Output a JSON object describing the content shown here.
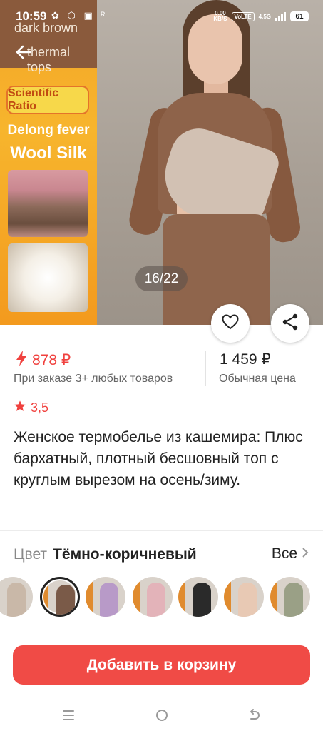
{
  "status_bar": {
    "time": "10:59",
    "net_speed_value": "0.00",
    "net_speed_unit": "KB/S",
    "volte": "VoLTE",
    "network": "4.5G",
    "battery": "61"
  },
  "gallery": {
    "counter": "16/22",
    "promo": {
      "color_name": "dark brown",
      "product_name": "thermal tops",
      "badge": "Scientific Ratio",
      "line1": "Delong fever",
      "line2": "Wool Silk"
    }
  },
  "price": {
    "promo_value": "878 ₽",
    "promo_note": "При заказе 3+ любых товаров",
    "regular_value": "1 459 ₽",
    "regular_note": "Обычная цена"
  },
  "rating": {
    "value": "3,5"
  },
  "product": {
    "title": "Женское термобелье из кашемира: Плюс бархатный, плотный бесшовный топ с круглым вырезом на осень/зиму."
  },
  "color_selector": {
    "label": "Цвет",
    "value": "Тёмно-коричневый",
    "all_label": "Все",
    "swatches": [
      {
        "name": "light-gray",
        "color": "#c9b8a8"
      },
      {
        "name": "dark-brown",
        "color": "#7a5a48"
      },
      {
        "name": "lavender",
        "color": "#b89ac8"
      },
      {
        "name": "pink",
        "color": "#e3b3b9"
      },
      {
        "name": "black",
        "color": "#2a2a2a"
      },
      {
        "name": "beige",
        "color": "#e8c9b4"
      },
      {
        "name": "green-gray",
        "color": "#9aa086"
      }
    ],
    "selected_index": 1
  },
  "cta": {
    "label": "Добавить в корзину"
  },
  "colors": {
    "accent": "#f04b46",
    "price_red": "#f0413e"
  }
}
